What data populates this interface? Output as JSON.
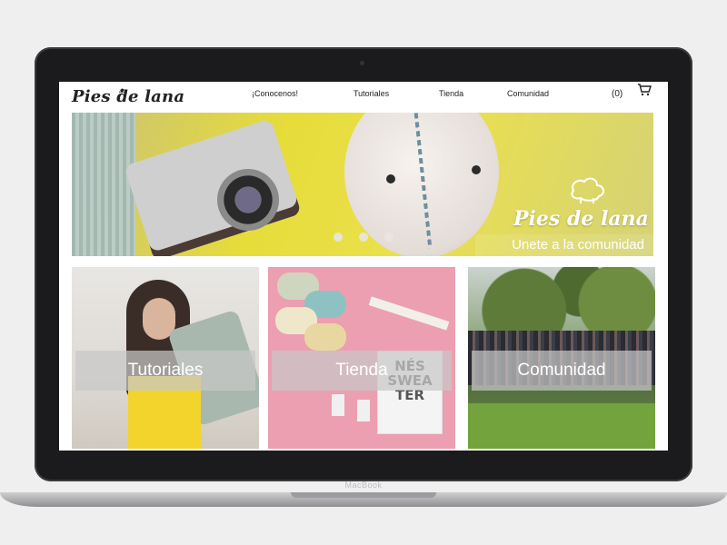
{
  "device": {
    "brand_label": "MacBook"
  },
  "site": {
    "logo_text": "Pies de lana",
    "nav": [
      {
        "label": "¡Conocenos!"
      },
      {
        "label": "Tutoriales"
      },
      {
        "label": "Tienda"
      },
      {
        "label": "Comunidad"
      }
    ],
    "cart": {
      "count_text": "(0)",
      "icon": "cart-icon"
    }
  },
  "hero": {
    "logo_text": "Pies de lana",
    "cta_text": "Unete a  la comunidad",
    "icon": "sheep-icon",
    "slider_dots": 3
  },
  "cards": [
    {
      "label": "Tutoriales"
    },
    {
      "label": "Tienda"
    },
    {
      "label": "Comunidad"
    }
  ],
  "card_art": {
    "book_text": "NÉS\nSWEA\nTER"
  },
  "colors": {
    "hero_yellow": "#e6dd3a",
    "card_overlay": "#c8c8c8",
    "shop_pink": "#ec9fb0",
    "laptop_frame": "#1b1b1d"
  }
}
